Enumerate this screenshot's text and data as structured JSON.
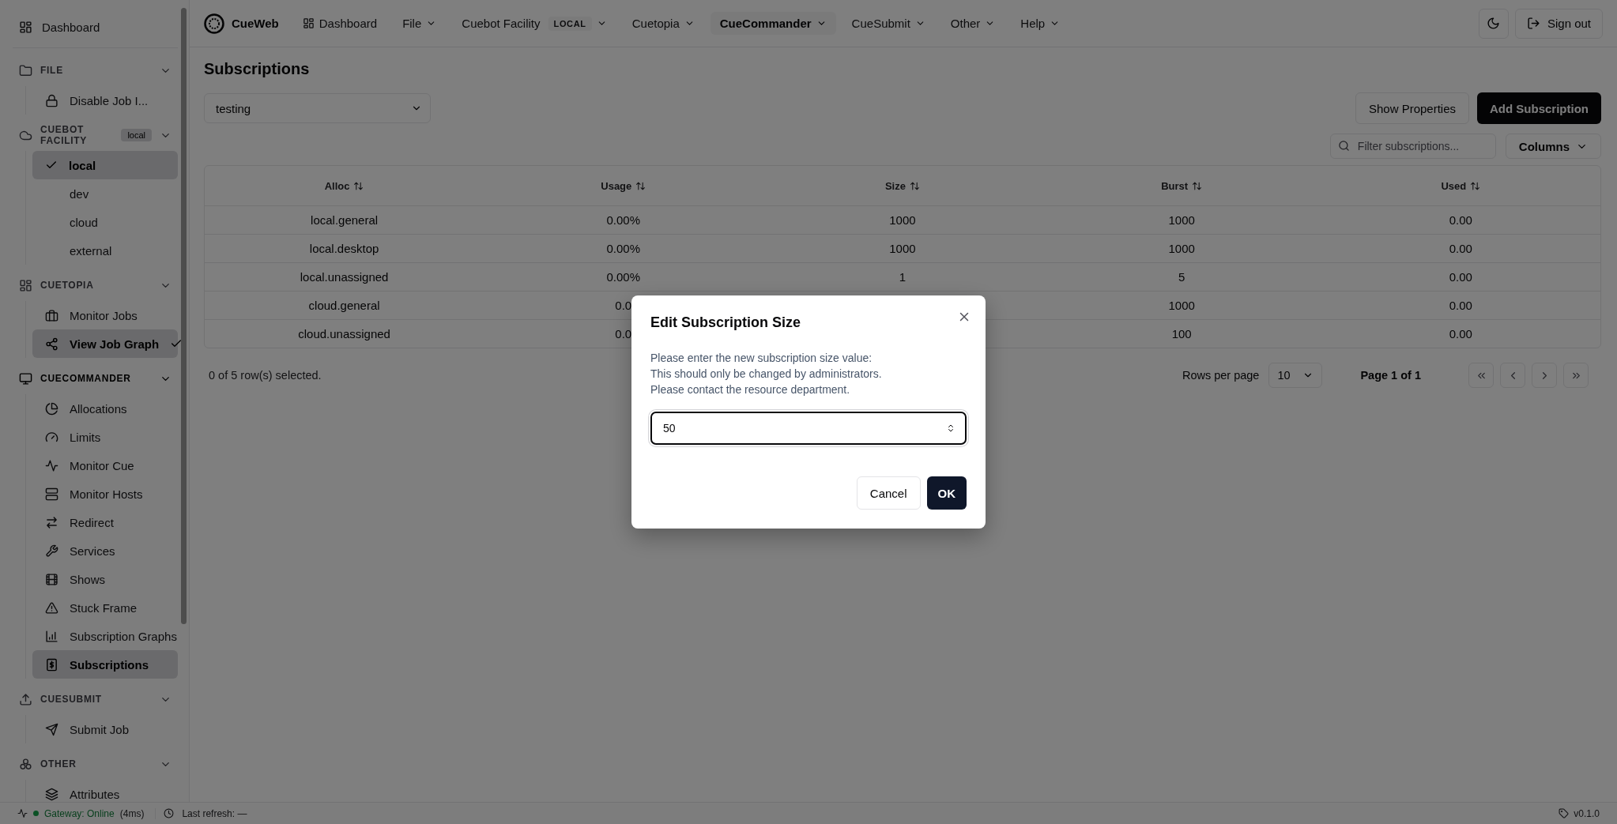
{
  "topbar": {
    "brand": "CueWeb",
    "menus": [
      {
        "label": "Dashboard",
        "kind": "link",
        "selected": false
      },
      {
        "label": "File",
        "kind": "menu",
        "selected": false
      },
      {
        "label": "Cuebot Facility",
        "badge": "LOCAL",
        "kind": "menu",
        "selected": false
      },
      {
        "label": "Cuetopia",
        "kind": "menu",
        "selected": false
      },
      {
        "label": "CueCommander",
        "kind": "menu",
        "selected": true
      },
      {
        "label": "CueSubmit",
        "kind": "menu",
        "selected": false
      },
      {
        "label": "Other",
        "kind": "menu",
        "selected": false
      },
      {
        "label": "Help",
        "kind": "menu",
        "selected": false
      }
    ],
    "sign_out": "Sign out"
  },
  "sidebar": {
    "home": "Dashboard",
    "sections": [
      {
        "title": "FILE",
        "active": false,
        "items": [
          {
            "label": "Disable Job I...",
            "selected": false,
            "checked": false
          }
        ]
      },
      {
        "title": "CUEBOT FACILITY",
        "badge": "local",
        "active": false,
        "items": [
          {
            "label": "local",
            "selected": true,
            "checked": true
          },
          {
            "label": "dev",
            "selected": false,
            "checked": false
          },
          {
            "label": "cloud",
            "selected": false,
            "checked": false
          },
          {
            "label": "external",
            "selected": false,
            "checked": false
          }
        ]
      },
      {
        "title": "CUETOPIA",
        "active": false,
        "items": [
          {
            "label": "Monitor Jobs",
            "selected": false,
            "checked": false
          },
          {
            "label": "View Job Graph",
            "selected": true,
            "checked": true
          }
        ]
      },
      {
        "title": "CUECOMMANDER",
        "active": true,
        "items": [
          {
            "label": "Allocations",
            "selected": false,
            "checked": false
          },
          {
            "label": "Limits",
            "selected": false,
            "checked": false
          },
          {
            "label": "Monitor Cue",
            "selected": false,
            "checked": false
          },
          {
            "label": "Monitor Hosts",
            "selected": false,
            "checked": false
          },
          {
            "label": "Redirect",
            "selected": false,
            "checked": false
          },
          {
            "label": "Services",
            "selected": false,
            "checked": false
          },
          {
            "label": "Shows",
            "selected": false,
            "checked": false
          },
          {
            "label": "Stuck Frame",
            "selected": false,
            "checked": false
          },
          {
            "label": "Subscription Graphs",
            "selected": false,
            "checked": false
          },
          {
            "label": "Subscriptions",
            "selected": true,
            "checked": false
          }
        ]
      },
      {
        "title": "CUESUBMIT",
        "active": false,
        "items": [
          {
            "label": "Submit Job",
            "selected": false,
            "checked": false
          }
        ]
      },
      {
        "title": "OTHER",
        "active": false,
        "items": [
          {
            "label": "Attributes",
            "selected": false,
            "checked": false
          }
        ]
      }
    ]
  },
  "page": {
    "title": "Subscriptions",
    "show_select": "testing",
    "buttons": [
      {
        "label": "Show Properties",
        "kind": "outline"
      },
      {
        "label": "Add Subscription",
        "kind": "primary"
      }
    ],
    "filter": {
      "placeholder": "Filter subscriptions..."
    },
    "columns_button": "Columns",
    "table": {
      "columns": [
        "Alloc",
        "Usage",
        "Size",
        "Burst",
        "Used"
      ],
      "rows": [
        [
          "local.general",
          "0.00%",
          "1000",
          "1000",
          "0.00"
        ],
        [
          "local.desktop",
          "0.00%",
          "1000",
          "1000",
          "0.00"
        ],
        [
          "local.unassigned",
          "0.00%",
          "1",
          "5",
          "0.00"
        ],
        [
          "cloud.general",
          "0.0",
          "",
          "1000",
          "0.00"
        ],
        [
          "cloud.unassigned",
          "0.0",
          "",
          "100",
          "0.00"
        ]
      ]
    },
    "selection_summary": "0 of 5 row(s) selected.",
    "pagination": {
      "rows_per_page_label": "Rows per page",
      "rows_per_page": "10",
      "page_label": "Page 1 of 1"
    }
  },
  "dialog": {
    "title": "Edit Subscription Size",
    "lines": [
      "Please enter the new subscription size value:",
      "This should only be changed by administrators.",
      "Please contact the resource department."
    ],
    "value": "50",
    "buttons": [
      {
        "label": "Cancel",
        "kind": "outline"
      },
      {
        "label": "OK",
        "kind": "primary"
      }
    ]
  },
  "status_bar": {
    "gateway": "Gateway: Online",
    "online": true,
    "latency": "(4ms)",
    "last_refresh": "Last refresh: —",
    "version": "v0.1.0"
  }
}
